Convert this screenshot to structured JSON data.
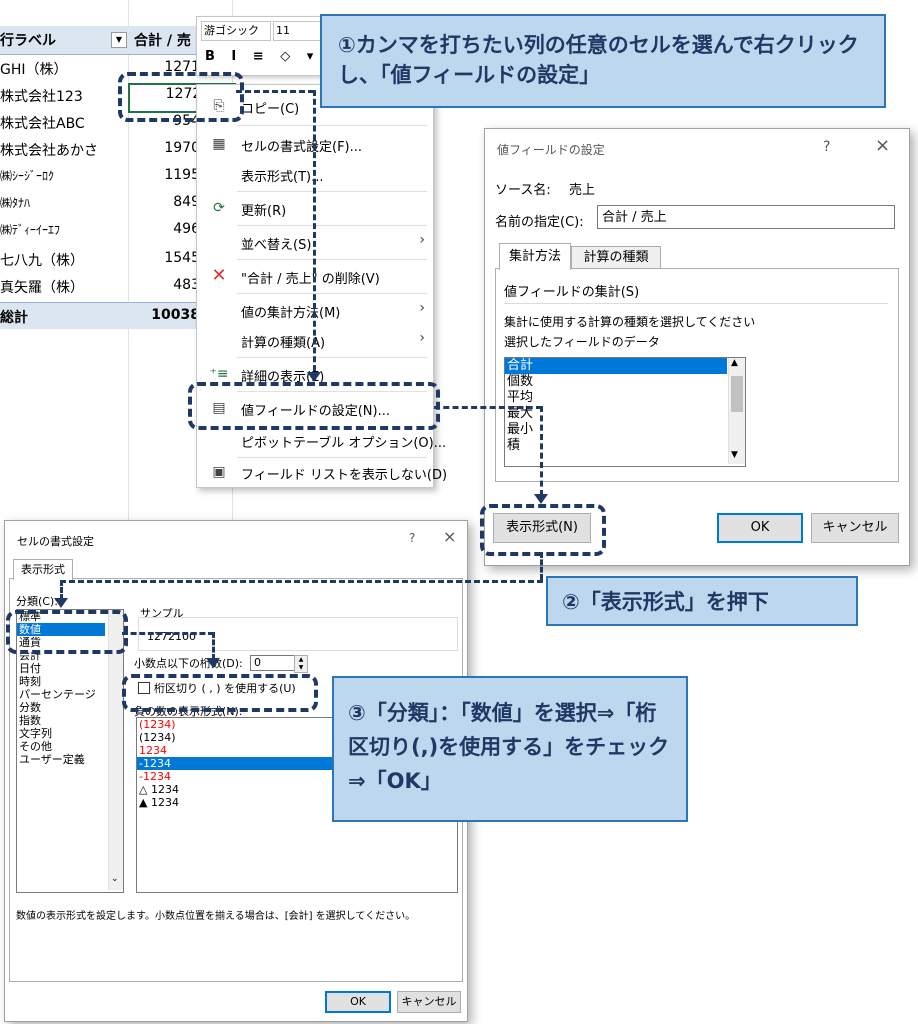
{
  "pivot": {
    "header_label": "行ラベル",
    "header_value": "合計 / 売",
    "rows": [
      {
        "label": "GHI（株）",
        "value": "1271"
      },
      {
        "label": "株式会社123",
        "value": "1272100"
      },
      {
        "label": "株式会社ABC",
        "value": "954"
      },
      {
        "label": "株式会社あかさ",
        "value": "1970"
      },
      {
        "label": "㈱ｼｰｼﾞｰﾛｸ",
        "value": "1195"
      },
      {
        "label": "㈱ﾀﾅﾊ",
        "value": "849"
      },
      {
        "label": "㈱ﾃﾞｨｰｲｰｴﾌ",
        "value": "496"
      },
      {
        "label": "七八九（株）",
        "value": "1545"
      },
      {
        "label": "真矢羅（株）",
        "value": "483"
      }
    ],
    "total_label": "総計",
    "total_value": "10038"
  },
  "mini_toolbar": {
    "font": "游ゴシック",
    "size": "11",
    "tools": "B I ≡ ◇ ▾"
  },
  "context_menu": {
    "items": [
      {
        "label": "コピー(C)",
        "icon": "copy-icon"
      },
      {
        "label": "セルの書式設定(F)...",
        "icon": "format-cells-icon"
      },
      {
        "label": "表示形式(T)...",
        "icon": ""
      },
      {
        "label": "更新(R)",
        "icon": "refresh-icon"
      },
      {
        "label": "並べ替え(S)",
        "icon": "",
        "submenu": true
      },
      {
        "label": "\"合計 / 売上\" の削除(V)",
        "icon": "delete-icon"
      },
      {
        "label": "値の集計方法(M)",
        "icon": "",
        "submenu": true
      },
      {
        "label": "計算の種類(A)",
        "icon": "",
        "submenu": true
      },
      {
        "label": "詳細の表示(E)",
        "icon": "details-icon"
      },
      {
        "label": "値フィールドの設定(N)...",
        "icon": "field-settings-icon"
      },
      {
        "label": "ピボットテーブル オプション(O)...",
        "icon": ""
      },
      {
        "label": "フィールド リストを表示しない(D)",
        "icon": "field-list-icon"
      }
    ]
  },
  "value_field_dialog": {
    "title": "値フィールドの設定",
    "help": "?",
    "close": "×",
    "source_label": "ソース名:",
    "source_value": "売上",
    "name_label": "名前の指定(C):",
    "name_value": "合計 / 売上",
    "tabs": [
      "集計方法",
      "計算の種類"
    ],
    "section": "値フィールドの集計(S)",
    "desc1": "集計に使用する計算の種類を選択してください",
    "desc2": "選択したフィールドのデータ",
    "list": [
      "合計",
      "個数",
      "平均",
      "最大",
      "最小",
      "積"
    ],
    "format_button": "表示形式(N)",
    "ok": "OK",
    "cancel": "キャンセル"
  },
  "format_cells_dialog": {
    "title": "セルの書式設定",
    "help": "?",
    "close": "×",
    "tab": "表示形式",
    "category_label": "分類(C):",
    "categories": [
      "標準",
      "数値",
      "通貨",
      "会計",
      "日付",
      "時刻",
      "パーセンテージ",
      "分数",
      "指数",
      "文字列",
      "その他",
      "ユーザー定義"
    ],
    "sample_label": "サンプル",
    "sample_value": "1272100",
    "decimal_label": "小数点以下の桁数(D):",
    "decimal_value": "0",
    "separator_label": "桁区切り ( , ) を使用する(U)",
    "negative_label": "負の数の表示形式(N):",
    "negatives": [
      {
        "text": "(1234)",
        "color": "#ff0000"
      },
      {
        "text": "(1234)",
        "color": "#000000"
      },
      {
        "text": "1234",
        "color": "#ff0000"
      },
      {
        "text": "-1234",
        "color": "#ffffff",
        "selected": true
      },
      {
        "text": "-1234",
        "color": "#ff0000"
      },
      {
        "text": "△ 1234",
        "color": "#000000"
      },
      {
        "text": "▲ 1234",
        "color": "#000000"
      }
    ],
    "footer": "数値の表示形式を設定します。小数点位置を揃える場合は、[会計] を選択してください。",
    "ok": "OK",
    "cancel": "キャンセル"
  },
  "callouts": {
    "step1": "①カンマを打ちたい列の任意のセルを選んで右クリックし、「値フィールドの設定」",
    "step2": "②「表示形式」を押下",
    "step3": "③「分類」：「数値」を選択⇒「桁区切り(,)を使用する」をチェック⇒「OK」"
  },
  "colors": {
    "callout_bg": "#bdd7ee",
    "callout_border": "#2e75b6",
    "dash": "#1f3864",
    "pivot_header": "#dce6f1",
    "selection": "#0078d7"
  }
}
